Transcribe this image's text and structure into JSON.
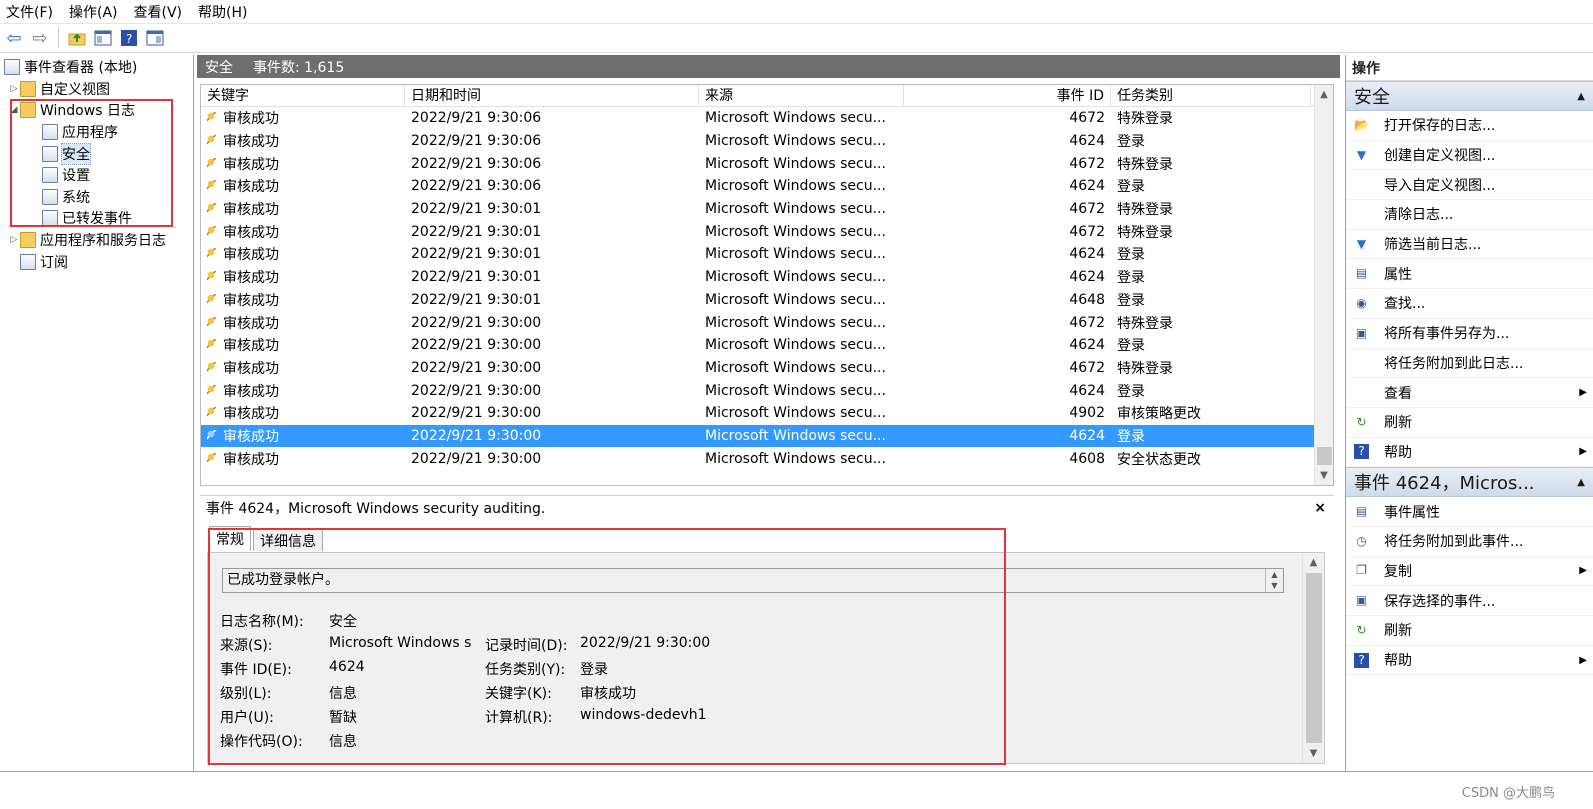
{
  "menu": [
    "文件(F)",
    "操作(A)",
    "查看(V)",
    "帮助(H)"
  ],
  "tree": {
    "items": [
      {
        "label": "事件查看器 (本地)",
        "level": 0,
        "expander": ""
      },
      {
        "label": "自定义视图",
        "level": 1,
        "expander": "▷"
      },
      {
        "label": "Windows 日志",
        "level": 1,
        "expander": "◢"
      },
      {
        "label": "应用程序",
        "level": 2,
        "expander": ""
      },
      {
        "label": "安全",
        "level": 2,
        "expander": ""
      },
      {
        "label": "设置",
        "level": 2,
        "expander": ""
      },
      {
        "label": "系统",
        "level": 2,
        "expander": ""
      },
      {
        "label": "已转发事件",
        "level": 2,
        "expander": ""
      },
      {
        "label": "应用程序和服务日志",
        "level": 1,
        "expander": "▷"
      },
      {
        "label": "订阅",
        "level": 1,
        "expander": ""
      }
    ]
  },
  "center": {
    "header_log": "安全",
    "header_count": "事件数: 1,615",
    "columns": [
      "关键字",
      "日期和时间",
      "来源",
      "事件 ID",
      "任务类别"
    ],
    "rows": [
      [
        "审核成功",
        "2022/9/21 9:30:06",
        "Microsoft Windows secu...",
        "4672",
        "特殊登录"
      ],
      [
        "审核成功",
        "2022/9/21 9:30:06",
        "Microsoft Windows secu...",
        "4624",
        "登录"
      ],
      [
        "审核成功",
        "2022/9/21 9:30:06",
        "Microsoft Windows secu...",
        "4672",
        "特殊登录"
      ],
      [
        "审核成功",
        "2022/9/21 9:30:06",
        "Microsoft Windows secu...",
        "4624",
        "登录"
      ],
      [
        "审核成功",
        "2022/9/21 9:30:01",
        "Microsoft Windows secu...",
        "4672",
        "特殊登录"
      ],
      [
        "审核成功",
        "2022/9/21 9:30:01",
        "Microsoft Windows secu...",
        "4672",
        "特殊登录"
      ],
      [
        "审核成功",
        "2022/9/21 9:30:01",
        "Microsoft Windows secu...",
        "4624",
        "登录"
      ],
      [
        "审核成功",
        "2022/9/21 9:30:01",
        "Microsoft Windows secu...",
        "4624",
        "登录"
      ],
      [
        "审核成功",
        "2022/9/21 9:30:01",
        "Microsoft Windows secu...",
        "4648",
        "登录"
      ],
      [
        "审核成功",
        "2022/9/21 9:30:00",
        "Microsoft Windows secu...",
        "4672",
        "特殊登录"
      ],
      [
        "审核成功",
        "2022/9/21 9:30:00",
        "Microsoft Windows secu...",
        "4624",
        "登录"
      ],
      [
        "审核成功",
        "2022/9/21 9:30:00",
        "Microsoft Windows secu...",
        "4672",
        "特殊登录"
      ],
      [
        "审核成功",
        "2022/9/21 9:30:00",
        "Microsoft Windows secu...",
        "4624",
        "登录"
      ],
      [
        "审核成功",
        "2022/9/21 9:30:00",
        "Microsoft Windows secu...",
        "4902",
        "审核策略更改"
      ],
      [
        "审核成功",
        "2022/9/21 9:30:00",
        "Microsoft Windows secu...",
        "4624",
        "登录"
      ],
      [
        "审核成功",
        "2022/9/21 9:30:00",
        "Microsoft Windows secu...",
        "4608",
        "安全状态更改"
      ]
    ],
    "selected_row": 14
  },
  "detail": {
    "title": "事件 4624，Microsoft Windows security auditing.",
    "close": "×",
    "tabs": [
      "常规",
      "详细信息"
    ],
    "description": "已成功登录帐户。",
    "fields": {
      "log_name_label": "日志名称(M):",
      "log_name": "安全",
      "source_label": "来源(S):",
      "source": "Microsoft Windows s",
      "logged_label": "记录时间(D):",
      "logged": "2022/9/21 9:30:00",
      "event_id_label": "事件 ID(E):",
      "event_id": "4624",
      "task_label": "任务类别(Y):",
      "task": "登录",
      "level_label": "级别(L):",
      "level": "信息",
      "keywords_label": "关键字(K):",
      "keywords": "审核成功",
      "user_label": "用户(U):",
      "user": "暂缺",
      "computer_label": "计算机(R):",
      "computer": "windows-dedevh1",
      "opcode_label": "操作代码(O):",
      "opcode": "信息"
    }
  },
  "actions": {
    "title": "操作",
    "section1": "安全",
    "items1": [
      "打开保存的日志...",
      "创建自定义视图...",
      "导入自定义视图...",
      "清除日志...",
      "筛选当前日志...",
      "属性",
      "查找...",
      "将所有事件另存为...",
      "将任务附加到此日志...",
      "查看",
      "刷新",
      "帮助"
    ],
    "section2": "事件 4624，Micros...",
    "items2": [
      "事件属性",
      "将任务附加到此事件...",
      "复制",
      "保存选择的事件...",
      "刷新",
      "帮助"
    ]
  },
  "watermark": "CSDN @大鹏鸟",
  "colors": {
    "selection": "#3399ff",
    "highlight_box": "#e8323a",
    "header_bar": "#6e6e6e"
  }
}
